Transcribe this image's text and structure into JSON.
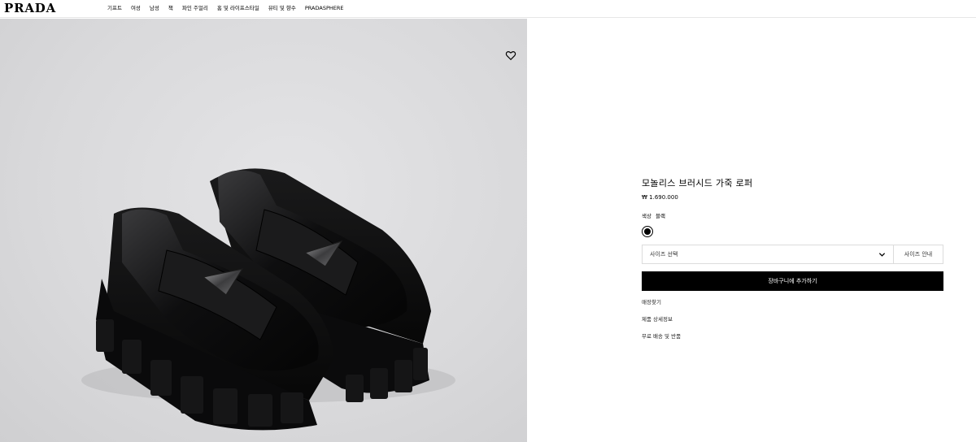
{
  "header": {
    "logo": "PRADA",
    "nav": [
      "기프트",
      "여성",
      "남성",
      "책",
      "파인 주얼리",
      "홈 및 라이프스타일",
      "뷰티 및 향수",
      "PRADASPHERE"
    ]
  },
  "product": {
    "title": "모놀리스 브러시드 가죽 로퍼",
    "price": "₩ 1.690.000",
    "color_label": "색상",
    "color_value": "블랙",
    "size_placeholder": "사이즈 선택",
    "size_guide": "사이즈 안내",
    "add_to_cart": "장바구니에 추가하기",
    "links": [
      "매장찾기",
      "제품 상세정보",
      "무료 배송 및 반품"
    ]
  },
  "colors": {
    "accent": "#000000",
    "image_bg": "#dadadc"
  }
}
